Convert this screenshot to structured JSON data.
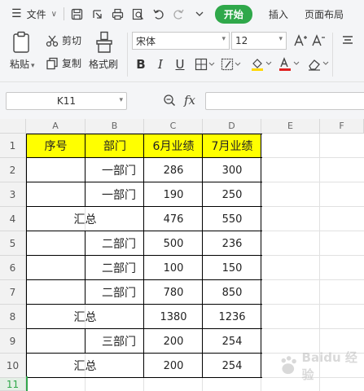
{
  "menubar": {
    "file_label": "文件",
    "tabs": [
      {
        "label": "开始",
        "active": true
      },
      {
        "label": "插入",
        "active": false
      },
      {
        "label": "页面布局",
        "active": false
      }
    ]
  },
  "ribbon": {
    "paste_label": "粘贴",
    "cut_label": "剪切",
    "copy_label": "复制",
    "format_painter_label": "格式刷",
    "font_name": "宋体",
    "font_size": "12"
  },
  "formula_bar": {
    "cell_ref": "K11",
    "fx_label": "fx",
    "value": ""
  },
  "sheet": {
    "columns": [
      "A",
      "B",
      "C",
      "D",
      "E",
      "F"
    ],
    "rows": [
      "1",
      "2",
      "3",
      "4",
      "5",
      "6",
      "7",
      "8",
      "9",
      "10",
      "11"
    ],
    "header": [
      "序号",
      "部门",
      "6月业绩",
      "7月业绩"
    ],
    "data_rows": [
      {
        "dept": "一部门",
        "jun": "286",
        "jul": "300"
      },
      {
        "dept": "一部门",
        "jun": "190",
        "jul": "250"
      },
      {
        "summary": "汇总",
        "jun": "476",
        "jul": "550"
      },
      {
        "dept": "二部门",
        "jun": "500",
        "jul": "236"
      },
      {
        "dept": "二部门",
        "jun": "100",
        "jul": "150"
      },
      {
        "dept": "二部门",
        "jun": "780",
        "jul": "850"
      },
      {
        "summary": "汇总",
        "jun": "1380",
        "jul": "1236"
      },
      {
        "dept": "三部门",
        "jun": "200",
        "jul": "254"
      },
      {
        "summary": "汇总",
        "jun": "200",
        "jul": "254"
      }
    ]
  },
  "colors": {
    "accent": "#2fa84a",
    "header_fill": "#ffff00"
  },
  "watermark": {
    "text": "Baidu 经验"
  }
}
